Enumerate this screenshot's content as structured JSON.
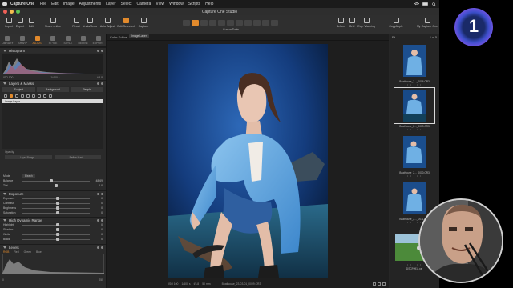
{
  "macmenu": {
    "app_name": "Capture One",
    "items": [
      "File",
      "Edit",
      "Image",
      "Adjustments",
      "Layer",
      "Select",
      "Camera",
      "View",
      "Window",
      "Scripts",
      "Help"
    ]
  },
  "window": {
    "title": "Capture One Studio"
  },
  "toolbar": {
    "left": [
      {
        "label": "Import",
        "icon": "import-icon"
      },
      {
        "label": "Export",
        "icon": "export-icon"
      },
      {
        "label": "Edit",
        "icon": "edit-icon"
      },
      {
        "label": "Share online",
        "icon": "share-icon"
      },
      {
        "label": "Reset",
        "icon": "reset-icon"
      },
      {
        "label": "Undo/Redo",
        "icon": "undo-icon"
      },
      {
        "label": "Auto Adjust",
        "icon": "auto-adjust-icon"
      },
      {
        "label": "Edit Selected",
        "icon": "edit-selected-icon"
      },
      {
        "label": "Capture",
        "icon": "capture-icon"
      }
    ],
    "cursor_tools_label": "Cursor Tools",
    "right": [
      {
        "label": "Before",
        "icon": "before-icon"
      },
      {
        "label": "Grid",
        "icon": "grid-icon"
      },
      {
        "label": "Exp. Warning",
        "icon": "warning-icon"
      },
      {
        "label": "CopyApply",
        "icon": "copy-apply-icon"
      },
      {
        "label": "My Capture One",
        "icon": "account-icon"
      }
    ]
  },
  "tool_tabs": [
    {
      "label": "LIBRARY",
      "active": false
    },
    {
      "label": "SHARP",
      "active": false
    },
    {
      "label": "ADJUST",
      "active": true
    },
    {
      "label": "STYLE",
      "active": false
    },
    {
      "label": "STYLE",
      "active": false
    },
    {
      "label": "REFINE",
      "active": false
    },
    {
      "label": "EXPORT",
      "active": false
    }
  ],
  "histogram": {
    "title": "Histogram",
    "iso": "ISO 100",
    "shutter": "1/400 s",
    "aperture": "f/3.8"
  },
  "layers": {
    "title": "Layers & Masks",
    "tabs": [
      "Subject",
      "Background",
      "People"
    ],
    "selected_layer": "Image Layer",
    "opacity_label": "Opacity",
    "btn_left": "Layer Range...",
    "btn_right": "Refine Mask..."
  },
  "style_section": {
    "mode_label": "Mode",
    "mode_value": "Bleach",
    "rows": [
      {
        "label": "Balance",
        "value": "48.69"
      },
      {
        "label": "Tint",
        "value": "-1.0"
      }
    ]
  },
  "exposure": {
    "title": "Exposure",
    "rows": [
      {
        "label": "Exposure",
        "value": "0"
      },
      {
        "label": "Contrast",
        "value": "0"
      },
      {
        "label": "Brightness",
        "value": "0"
      },
      {
        "label": "Saturation",
        "value": "0"
      }
    ]
  },
  "hdr": {
    "title": "High Dynamic Range",
    "rows": [
      {
        "label": "Highlight",
        "value": "0"
      },
      {
        "label": "Shadow",
        "value": "0"
      },
      {
        "label": "White",
        "value": "0"
      },
      {
        "label": "Black",
        "value": "0"
      }
    ]
  },
  "levels": {
    "title": "Levels",
    "channels": [
      "RGB",
      "Red",
      "Green",
      "Blue"
    ],
    "low": "0",
    "high": "255"
  },
  "viewer": {
    "panel_title": "Color Editor",
    "layer_pill": "Image Layer",
    "status": [
      "ISO 100",
      "1/400 s",
      "f/3.8",
      "50 mm"
    ],
    "filename": "Boathouse_23-03-01_0009.CR3"
  },
  "browser": {
    "count": "1 of 5",
    "fit": "Fit",
    "thumbs": [
      {
        "name": "Boathouse_2..._0006.CR3",
        "selected": false
      },
      {
        "name": "Boathouse_2..._0009.CR3",
        "selected": true
      },
      {
        "name": "Boathouse_2..._0010.CR3",
        "selected": false
      },
      {
        "name": "Boathouse_2..._0011.CR3",
        "selected": false
      },
      {
        "name": "DSCF0911.raf",
        "selected": false
      }
    ]
  },
  "brand": {
    "logo_text": "1"
  },
  "colors": {
    "accent": "#e28a2c",
    "panel": "#2a2a2a",
    "photo_bg": "#163a78",
    "jacket": "#5ea3dc"
  }
}
